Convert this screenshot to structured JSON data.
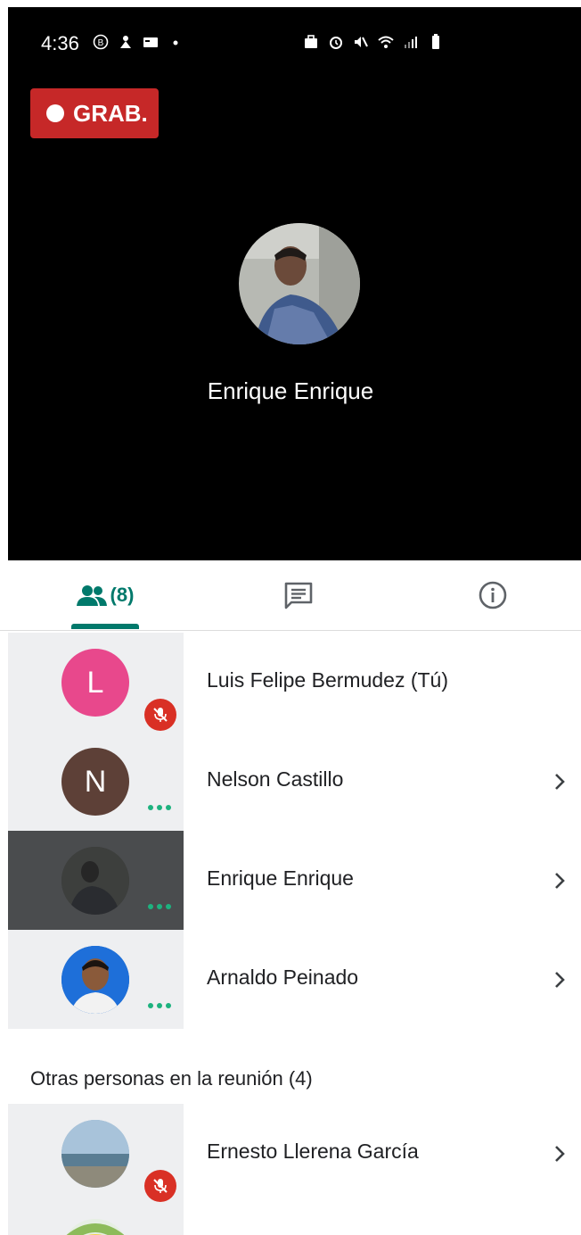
{
  "status_bar": {
    "time": "4:36"
  },
  "recording": {
    "label": "GRAB."
  },
  "speaker": {
    "name": "Enrique Enrique"
  },
  "tabs": {
    "people_count": "(8)"
  },
  "participants": [
    {
      "name": "Luis Felipe Bermudez (Tú)",
      "initial": "L",
      "avatar_color": "#e8488c",
      "muted": true
    },
    {
      "name": "Nelson Castillo",
      "initial": "N",
      "avatar_color": "#5d4037",
      "muted": false
    },
    {
      "name": "Enrique Enrique",
      "initial": "",
      "avatar_color": "#3a3a3a",
      "muted": false
    },
    {
      "name": "Arnaldo Peinado",
      "initial": "",
      "avatar_color": "#1565c0",
      "muted": false
    }
  ],
  "others_section": {
    "title": "Otras personas en la reunión (4)"
  },
  "others": [
    {
      "name": "Ernesto Llerena García",
      "muted": true
    }
  ],
  "colors": {
    "accent": "#00796b",
    "recording": "#c62828",
    "mute": "#d93025"
  }
}
